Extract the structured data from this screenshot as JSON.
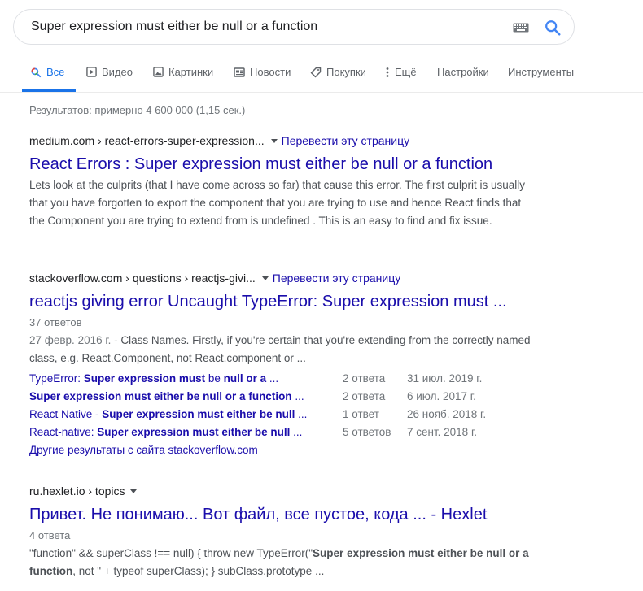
{
  "search": {
    "query": "Super expression must either be null or a function"
  },
  "tabs": [
    {
      "label": "Все",
      "icon": "search-icon",
      "active": true
    },
    {
      "label": "Видео",
      "icon": "play-icon"
    },
    {
      "label": "Картинки",
      "icon": "image-icon"
    },
    {
      "label": "Новости",
      "icon": "news-icon"
    },
    {
      "label": "Покупки",
      "icon": "tag-icon"
    },
    {
      "label": "Ещё",
      "icon": "more-vert-icon"
    },
    {
      "label": "Настройки"
    },
    {
      "label": "Инструменты"
    }
  ],
  "stats": "Результатов: примерно 4 600 000 (1,15 сек.)",
  "results": [
    {
      "cite": "medium.com › react-errors-super-expression...",
      "translate": "Перевести эту страницу",
      "title": "React Errors : Super expression must either be null or a function",
      "snippet": "Lets look at the culprits (that I have come across so far) that cause this error. The first culprit is usually that you have forgotten to export the component that you are trying to use and hence React finds that the Component you are trying to extend from is undefined . This is an easy to find and fix issue."
    },
    {
      "cite": "stackoverflow.com › questions › reactjs-givi...",
      "translate": "Перевести эту страницу",
      "title": "reactjs giving error Uncaught TypeError: Super expression must ...",
      "meta": "37 ответов",
      "date": "27 февр. 2016 г.",
      "snippet": " - Class Names. Firstly, if you're certain that you're extending from the correctly named class, e.g. React.Component, not React.component or ...",
      "sublinks": [
        {
          "prefix": "TypeError: ",
          "bold": "Super expression must",
          "mid": " be ",
          "bold2": "null or a",
          "suffix": " ...",
          "count": "2 ответа",
          "date": "31 июл. 2019 г."
        },
        {
          "prefix": "",
          "bold": "Super expression must either be null or a function",
          "mid": "",
          "bold2": "",
          "suffix": " ...",
          "count": "2 ответа",
          "date": "6 июл. 2017 г."
        },
        {
          "prefix": "React Native - ",
          "bold": "Super expression must either be null",
          "mid": "",
          "bold2": "",
          "suffix": " ...",
          "count": "1 ответ",
          "date": "26 нояб. 2018 г."
        },
        {
          "prefix": "React-native: ",
          "bold": "Super expression must either be null",
          "mid": "",
          "bold2": "",
          "suffix": " ...",
          "count": "5 ответов",
          "date": "7 сент. 2018 г."
        }
      ],
      "more": "Другие результаты с сайта stackoverflow.com"
    },
    {
      "cite": "ru.hexlet.io › topics",
      "title": "Привет. Не понимаю... Вот файл, все пустое, кода ... - Hexlet",
      "meta": "4 ответа",
      "snippet_pre": "\"function\" && superClass !== null) { throw new TypeError(\"",
      "snippet_bold": "Super expression must either be null or a function",
      "snippet_post": ", not \" + typeof superClass); } subClass.prototype ..."
    }
  ]
}
